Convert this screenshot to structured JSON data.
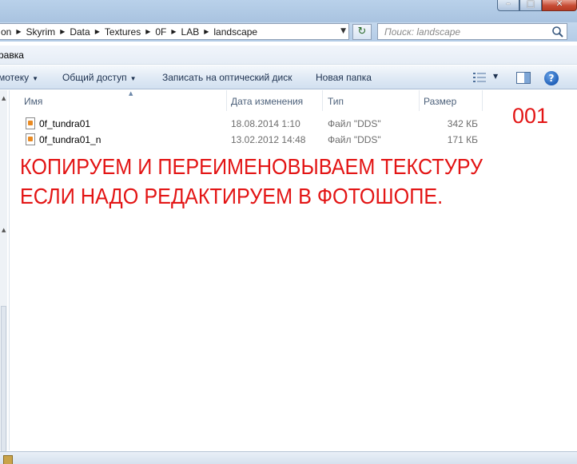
{
  "window": {
    "controls": {
      "minimize": "–",
      "maximize": "□",
      "close": "✕"
    }
  },
  "address": {
    "breadcrumbs": [
      "on",
      "Skyrim",
      "Data",
      "Textures",
      "0F",
      "LAB",
      "landscape"
    ],
    "search_placeholder": "Поиск: landscape"
  },
  "menubar": {
    "item": "равка"
  },
  "toolbar": {
    "library_label": "мотеку",
    "share_label": "Общий доступ",
    "burn_label": "Записать на оптический диск",
    "new_folder_label": "Новая папка"
  },
  "columns": {
    "name": "Имя",
    "date": "Дата изменения",
    "type": "Тип",
    "size": "Размер"
  },
  "files": [
    {
      "name": "0f_tundra01",
      "date": "18.08.2014 1:10",
      "type": "Файл \"DDS\"",
      "size": "342 КБ"
    },
    {
      "name": "0f_tundra01_n",
      "date": "13.02.2012 14:48",
      "type": "Файл \"DDS\"",
      "size": "171 КБ"
    }
  ],
  "annotation": {
    "number": "001",
    "line1": "КОПИРУЕМ И ПЕРЕИМЕНОВЫВАЕМ ТЕКСТУРУ",
    "line2": "ЕСЛИ НАДО РЕДАКТИРУЕМ В ФОТОШОПЕ."
  },
  "colors": {
    "annotation": "#e31515",
    "toolbar_text": "#1e3250",
    "column_header_text": "#4c607a"
  },
  "icons": {
    "file": "dds-file-icon",
    "search": "search-icon",
    "refresh": "refresh-icon",
    "help": "help-icon",
    "views": "views-icon",
    "preview_pane": "preview-pane-icon"
  }
}
